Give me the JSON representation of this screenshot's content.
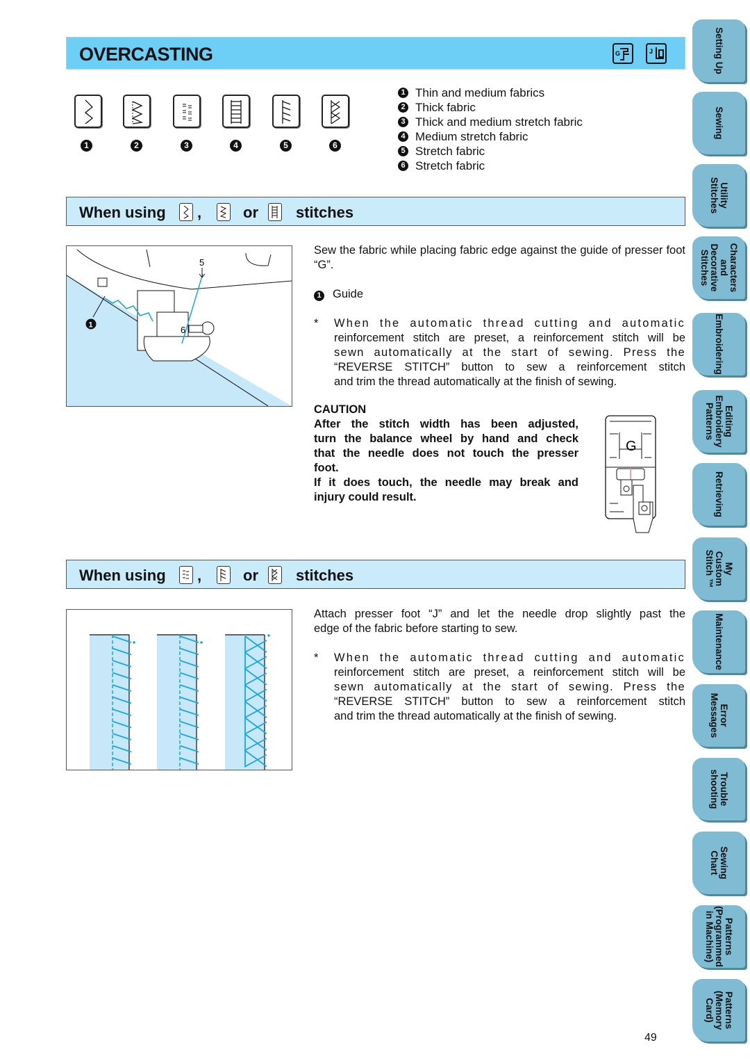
{
  "header": {
    "title": "OVERCASTING",
    "foot_icons": [
      {
        "name": "presser-foot-g-icon",
        "letter": "G"
      },
      {
        "name": "presser-foot-j-icon",
        "letter": "J"
      }
    ]
  },
  "stitches": [
    {
      "number": "1",
      "description": "Thin and medium fabrics"
    },
    {
      "number": "2",
      "description": "Thick fabric"
    },
    {
      "number": "3",
      "description": "Thick and medium stretch fabric"
    },
    {
      "number": "4",
      "description": "Medium stretch fabric"
    },
    {
      "number": "5",
      "description": "Stretch fabric"
    },
    {
      "number": "6",
      "description": "Stretch fabric"
    }
  ],
  "section1": {
    "heading_prefix": "When using",
    "comma": ",",
    "or": "or",
    "heading_suffix": "stitches",
    "figure_labels": {
      "callout": "1",
      "thread_mark_top": "5",
      "thread_mark_foot": "6"
    },
    "instruction": "Sew the fabric while placing fabric edge against the guide of presser foot “G”.",
    "callout_number": "1",
    "callout_label": "Guide",
    "note_marker": "*",
    "note_first_line": "When the automatic thread cutting and automatic",
    "note_lines": [
      "reinforcement stitch are preset, a reinforcement stitch will be",
      "sewn automatically at the start of sewing. Press the",
      "“REVERSE STITCH” button to sew a reinforcement stitch"
    ],
    "note_last_line": "and trim the thread automatically at the finish of sewing.",
    "caution_title": "CAUTION",
    "caution_lines": [
      "After the stitch width has been adjusted,",
      "turn the balance wheel by hand and check",
      "that the needle does not touch the presser"
    ],
    "caution_line_end": "foot.",
    "caution_lines2": [
      "If it does touch, the needle may break and"
    ],
    "caution_line2_end": "injury could result.",
    "foot_letter": "G"
  },
  "section2": {
    "heading_prefix": "When using",
    "comma": ",",
    "or": "or",
    "heading_suffix": "stitches",
    "instruction_line1": "Attach presser foot “J” and let the needle drop slightly past the",
    "instruction_line2": "edge of the fabric before starting to sew.",
    "note_marker": "*",
    "note_first_line": "When the automatic thread cutting and automatic",
    "note_lines": [
      "reinforcement stitch are preset, a reinforcement stitch will be",
      "sewn automatically at the start of sewing. Press the",
      "“REVERSE STITCH” button to sew a reinforcement stitch"
    ],
    "note_last_line": "and trim the thread automatically at the finish of sewing."
  },
  "side_tabs": [
    {
      "label": "Setting Up"
    },
    {
      "label": "Sewing"
    },
    {
      "label": "Utility\nStitches"
    },
    {
      "label": "Characters\nand\nDecorative\nStitches"
    },
    {
      "label": "Embroidering"
    },
    {
      "label": "Editing\nEmbroidery\nPatterns"
    },
    {
      "label": "Retrieving"
    },
    {
      "label": "My\nCustom\nStitch ™"
    },
    {
      "label": "Maintenance"
    },
    {
      "label": "Error\nMessages"
    },
    {
      "label": "Trouble\nshooting"
    },
    {
      "label": "Sewing\nChart"
    },
    {
      "label": "Patterns\n(Programmed\nin Machine)"
    },
    {
      "label": "Patterns\n(Memory\nCard)"
    }
  ],
  "page_number": "49",
  "colors": {
    "title_bar": "#6dcff5",
    "section_bar": "#c9ebfa",
    "fabric": "#c6e8f8",
    "thread": "#1aa6e8",
    "tab": "#7fbcd3"
  }
}
